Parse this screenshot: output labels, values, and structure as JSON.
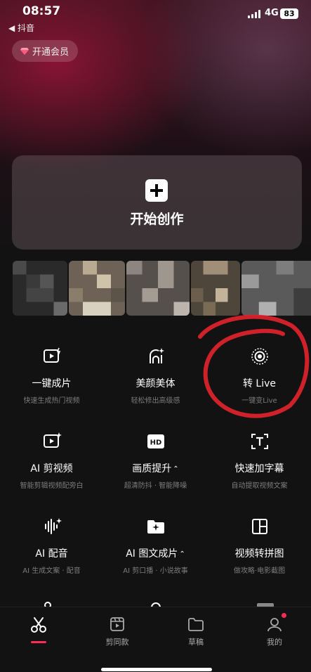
{
  "status_bar": {
    "time": "08:57",
    "back_app": "◀ 抖音",
    "network": "4G",
    "battery": "83"
  },
  "vip": {
    "label": "开通会员"
  },
  "start": {
    "label": "开始创作"
  },
  "tools": [
    {
      "title": "一键成片",
      "subtitle": "快速生成热门视频",
      "icon": "video-spark-icon"
    },
    {
      "title": "美颜美体",
      "subtitle": "轻松修出高级感",
      "icon": "face-sparkle-icon"
    },
    {
      "title": "转 Live",
      "subtitle": "一键变Live",
      "icon": "live-photo-icon"
    },
    {
      "title": "AI 剪视频",
      "subtitle": "智能剪辑视频配旁白",
      "icon": "ai-video-icon"
    },
    {
      "title": "画质提升",
      "subtitle": "超清防抖 · 智能降噪",
      "icon": "hd-icon",
      "has_caret": true
    },
    {
      "title": "快速加字幕",
      "subtitle": "自动提取视频文案",
      "icon": "caption-icon"
    },
    {
      "title": "AI 配音",
      "subtitle": "AI 生成文案 · 配音",
      "icon": "waveform-icon"
    },
    {
      "title": "AI 图文成片",
      "subtitle": "AI 剪口播 · 小说故事",
      "icon": "folder-sparkle-icon",
      "has_caret": true
    },
    {
      "title": "视频转拼图",
      "subtitle": "做攻略·电影截图",
      "icon": "grid-layout-icon"
    }
  ],
  "nav": [
    {
      "label": "",
      "icon": "scissors-icon",
      "active": true
    },
    {
      "label": "剪同款",
      "icon": "template-icon"
    },
    {
      "label": "草稿",
      "icon": "folder-icon"
    },
    {
      "label": "我的",
      "icon": "profile-icon",
      "badge": true
    }
  ],
  "colors": {
    "accent": "#fe2c55",
    "background": "#121212",
    "subtitle": "#7c7c7c"
  }
}
